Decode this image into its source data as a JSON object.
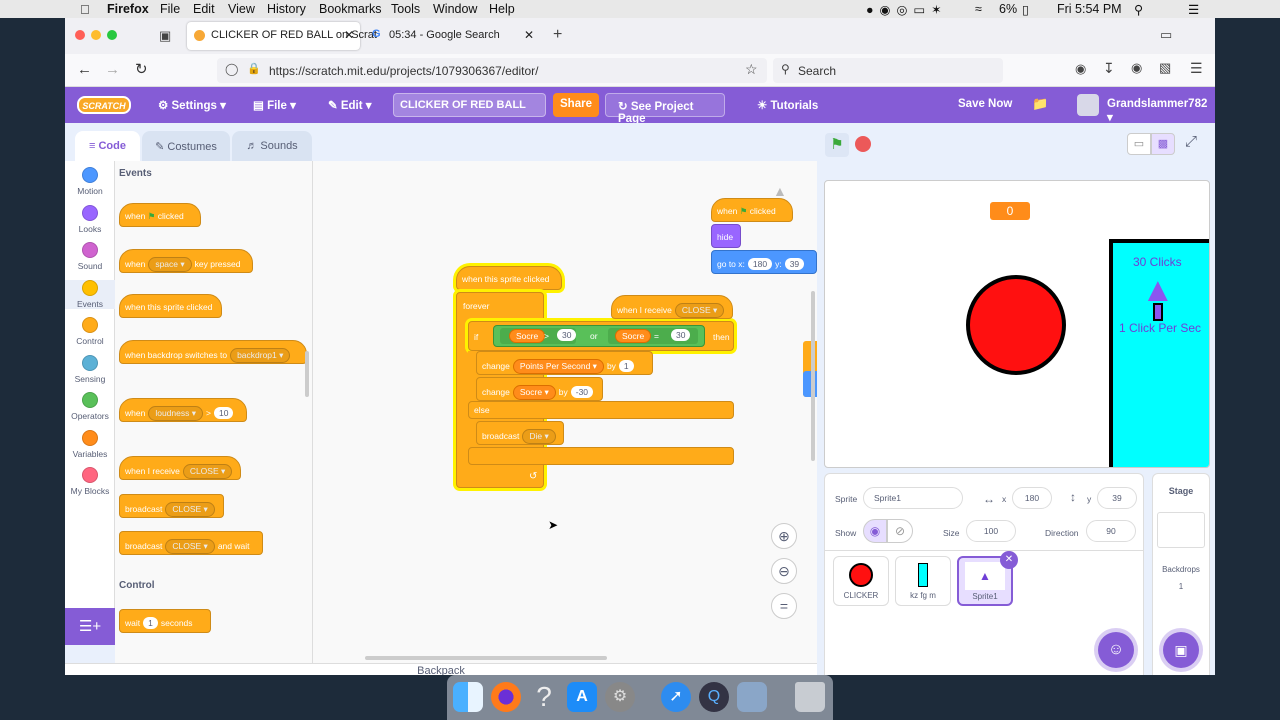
{
  "macmenu": {
    "app": "Firefox",
    "items": [
      "File",
      "Edit",
      "View",
      "History",
      "Bookmarks",
      "Tools",
      "Window",
      "Help"
    ],
    "battery": "6%",
    "clock": "Fri 5:54 PM"
  },
  "browser": {
    "tabs": [
      {
        "title": "CLICKER OF RED BALL on Scrat"
      },
      {
        "title": "05:34 - Google Search"
      }
    ],
    "url": "https://scratch.mit.edu/projects/1079306367/editor/",
    "search_placeholder": "Search"
  },
  "scratch_menu": {
    "logo": "SCRATCH",
    "settings": "Settings",
    "file": "File",
    "edit": "Edit",
    "project_title": "CLICKER OF RED BALL",
    "share": "Share",
    "see_project": "See Project Page",
    "tutorials": "Tutorials",
    "save_now": "Save Now",
    "username": "Grandslammer782"
  },
  "editor_tabs": {
    "code": "Code",
    "costumes": "Costumes",
    "sounds": "Sounds"
  },
  "categories": [
    {
      "label": "Motion",
      "color": "#4c97ff"
    },
    {
      "label": "Looks",
      "color": "#9966ff"
    },
    {
      "label": "Sound",
      "color": "#cf63cf"
    },
    {
      "label": "Events",
      "color": "#ffbf00"
    },
    {
      "label": "Control",
      "color": "#ffab19"
    },
    {
      "label": "Sensing",
      "color": "#5cb1d6"
    },
    {
      "label": "Operators",
      "color": "#59c059"
    },
    {
      "label": "Variables",
      "color": "#ff8c1a"
    },
    {
      "label": "My Blocks",
      "color": "#ff6680"
    }
  ],
  "palette": {
    "events_heading": "Events",
    "control_heading": "Control",
    "when_flag": {
      "a": "when",
      "b": "clicked"
    },
    "when_key": {
      "a": "when",
      "key": "space",
      "b": "key pressed"
    },
    "when_sprite": "when this sprite clicked",
    "when_backdrop": {
      "a": "when backdrop switches to",
      "val": "backdrop1"
    },
    "when_loud": {
      "a": "when",
      "val": "loudness",
      "op": ">",
      "num": "10"
    },
    "when_receive": {
      "a": "when I receive",
      "val": "CLOSE"
    },
    "broadcast": {
      "a": "broadcast",
      "val": "CLOSE"
    },
    "broadcast_wait": {
      "a": "broadcast",
      "val": "CLOSE",
      "b": "and wait"
    },
    "wait": {
      "a": "wait",
      "num": "1",
      "b": "seconds"
    }
  },
  "script": {
    "hat": "when this sprite clicked",
    "forever": "forever",
    "if": "if",
    "score1": "Socre",
    "gt": ">",
    "n30a": "30",
    "or": "or",
    "score2": "Socre",
    "eq": "=",
    "n30b": "30",
    "then": "then",
    "change1": {
      "a": "change",
      "var": "Points Per Second",
      "by": "by",
      "num": "1"
    },
    "change2": {
      "a": "change",
      "var": "Socre",
      "by": "by",
      "num": "-30"
    },
    "else": "else",
    "broadcast": {
      "a": "broadcast",
      "val": "Die"
    },
    "receive": {
      "a": "when I receive",
      "val": "CLOSE"
    },
    "flag_script": {
      "when": "when",
      "clicked": "clicked",
      "hide": "hide",
      "goto": "go to x:",
      "x": "180",
      "ylabel": "y:",
      "y": "39"
    }
  },
  "backpack": "Backpack",
  "stage": {
    "score_value": "0",
    "panel_line1": "30 Clicks",
    "panel_line2": "1 Click Per Sec"
  },
  "sprite_info": {
    "sprite_label": "Sprite",
    "sprite_name": "Sprite1",
    "x_label": "x",
    "x": "180",
    "y_label": "y",
    "y": "39",
    "show_label": "Show",
    "size_label": "Size",
    "size": "100",
    "direction_label": "Direction",
    "direction": "90"
  },
  "sprites": [
    {
      "name": "CLICKER"
    },
    {
      "name": "kz fg m"
    },
    {
      "name": "Sprite1"
    }
  ],
  "stage_panel": {
    "title": "Stage",
    "backdrops_label": "Backdrops",
    "backdrops_count": "1"
  }
}
